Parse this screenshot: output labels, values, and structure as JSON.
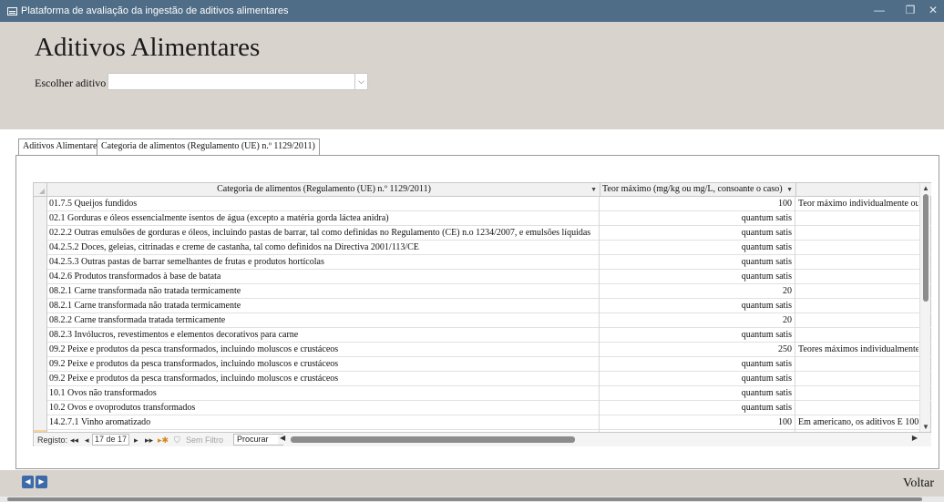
{
  "window": {
    "title": "Plataforma de avaliação da ingestão de aditivos alimentares",
    "minimize": "—",
    "restore": "❐",
    "close": "✕"
  },
  "header": {
    "title": "Aditivos Alimentares",
    "choose_label": "Escolher aditivo",
    "choose_value": ""
  },
  "tabs": [
    {
      "label": "Aditivos Alimentares"
    },
    {
      "label": "Categoria de alimentos (Regulamento (UE) n.º 1129/2011)"
    }
  ],
  "grid": {
    "columns": [
      "Categoria de alimentos (Regulamento (UE) n.º 1129/2011)",
      "Teor máximo (mg/kg ou mg/L, consoante o caso)",
      ""
    ],
    "rows": [
      {
        "cat": "01.7.5 Queijos fundidos",
        "teor": "100",
        "nota": "Teor máximo individualmente ou"
      },
      {
        "cat": "02.1 Gorduras e óleos essencialmente isentos de água (excepto a matéria gorda láctea anidra)",
        "teor": "quantum satis",
        "nota": ""
      },
      {
        "cat": "02.2.2 Outras emulsões de gorduras e óleos, incluindo pastas de barrar, tal como definidas no Regulamento (CE) n.o 1234/2007, e emulsões líquidas",
        "teor": "quantum satis",
        "nota": ""
      },
      {
        "cat": "04.2.5.2 Doces, geleias, citrinadas e creme de castanha, tal como definidos na Directiva 2001/113/CE",
        "teor": "quantum satis",
        "nota": ""
      },
      {
        "cat": "04.2.5.3 Outras pastas de barrar semelhantes de frutas e produtos hortícolas",
        "teor": "quantum satis",
        "nota": ""
      },
      {
        "cat": "04.2.6 Produtos transformados à base de batata",
        "teor": "quantum satis",
        "nota": ""
      },
      {
        "cat": "08.2.1 Carne transformada não tratada termicamente",
        "teor": "20",
        "nota": ""
      },
      {
        "cat": "08.2.1 Carne transformada não tratada termicamente",
        "teor": "quantum satis",
        "nota": ""
      },
      {
        "cat": "08.2.2 Carne transformada tratada termicamente",
        "teor": "20",
        "nota": ""
      },
      {
        "cat": "08.2.3 Invólucros, revestimentos e elementos decorativos para carne",
        "teor": "quantum satis",
        "nota": ""
      },
      {
        "cat": "09.2 Peixe e produtos da pesca transformados, incluindo moluscos e crustáceos",
        "teor": "250",
        "nota": "Teores máximos individualmente"
      },
      {
        "cat": "09.2 Peixe e produtos da pesca transformados, incluindo moluscos e crustáceos",
        "teor": "quantum satis",
        "nota": ""
      },
      {
        "cat": "09.2 Peixe e produtos da pesca transformados, incluindo moluscos e crustáceos",
        "teor": "quantum satis",
        "nota": ""
      },
      {
        "cat": "10.1 Ovos não transformados",
        "teor": "quantum satis",
        "nota": ""
      },
      {
        "cat": "10.2 Ovos e ovoprodutos transformados",
        "teor": "quantum satis",
        "nota": ""
      },
      {
        "cat": "14.2.7.1 Vinho aromatizado",
        "teor": "100",
        "nota": "Em americano, os aditivos E 100,"
      },
      {
        "cat": "",
        "teor": "",
        "nota": ""
      }
    ]
  },
  "record_nav": {
    "label": "Registo:",
    "first": "◂◂",
    "prev": "◂",
    "counter": "17 de 17",
    "next": "▸",
    "last": "▸▸",
    "new": "▸✱",
    "filter": "Sem Filtro",
    "search": "Procurar"
  },
  "footer": {
    "back_label": "Voltar",
    "prev_arrow": "◀",
    "next_arrow": "▶"
  }
}
